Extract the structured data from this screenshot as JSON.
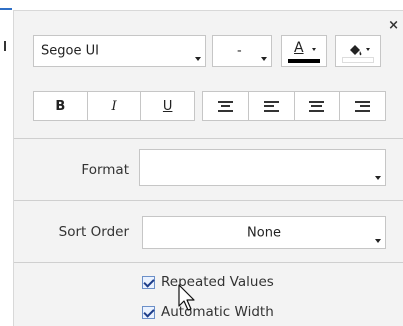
{
  "font": {
    "family_value": "Segoe UI",
    "size_value": "-",
    "font_color_glyph": "A",
    "font_color": "#000000",
    "fill_color": "#ffffff"
  },
  "style_buttons": {
    "bold": "B",
    "italic": "I",
    "underline": "U"
  },
  "format": {
    "label": "Format",
    "value": ""
  },
  "sort_order": {
    "label": "Sort Order",
    "value": "None"
  },
  "options": {
    "repeated_values": {
      "label": "Repeated Values",
      "checked": true
    },
    "automatic_width": {
      "label": "Automatic Width",
      "checked": true
    }
  },
  "close_symbol": "×"
}
